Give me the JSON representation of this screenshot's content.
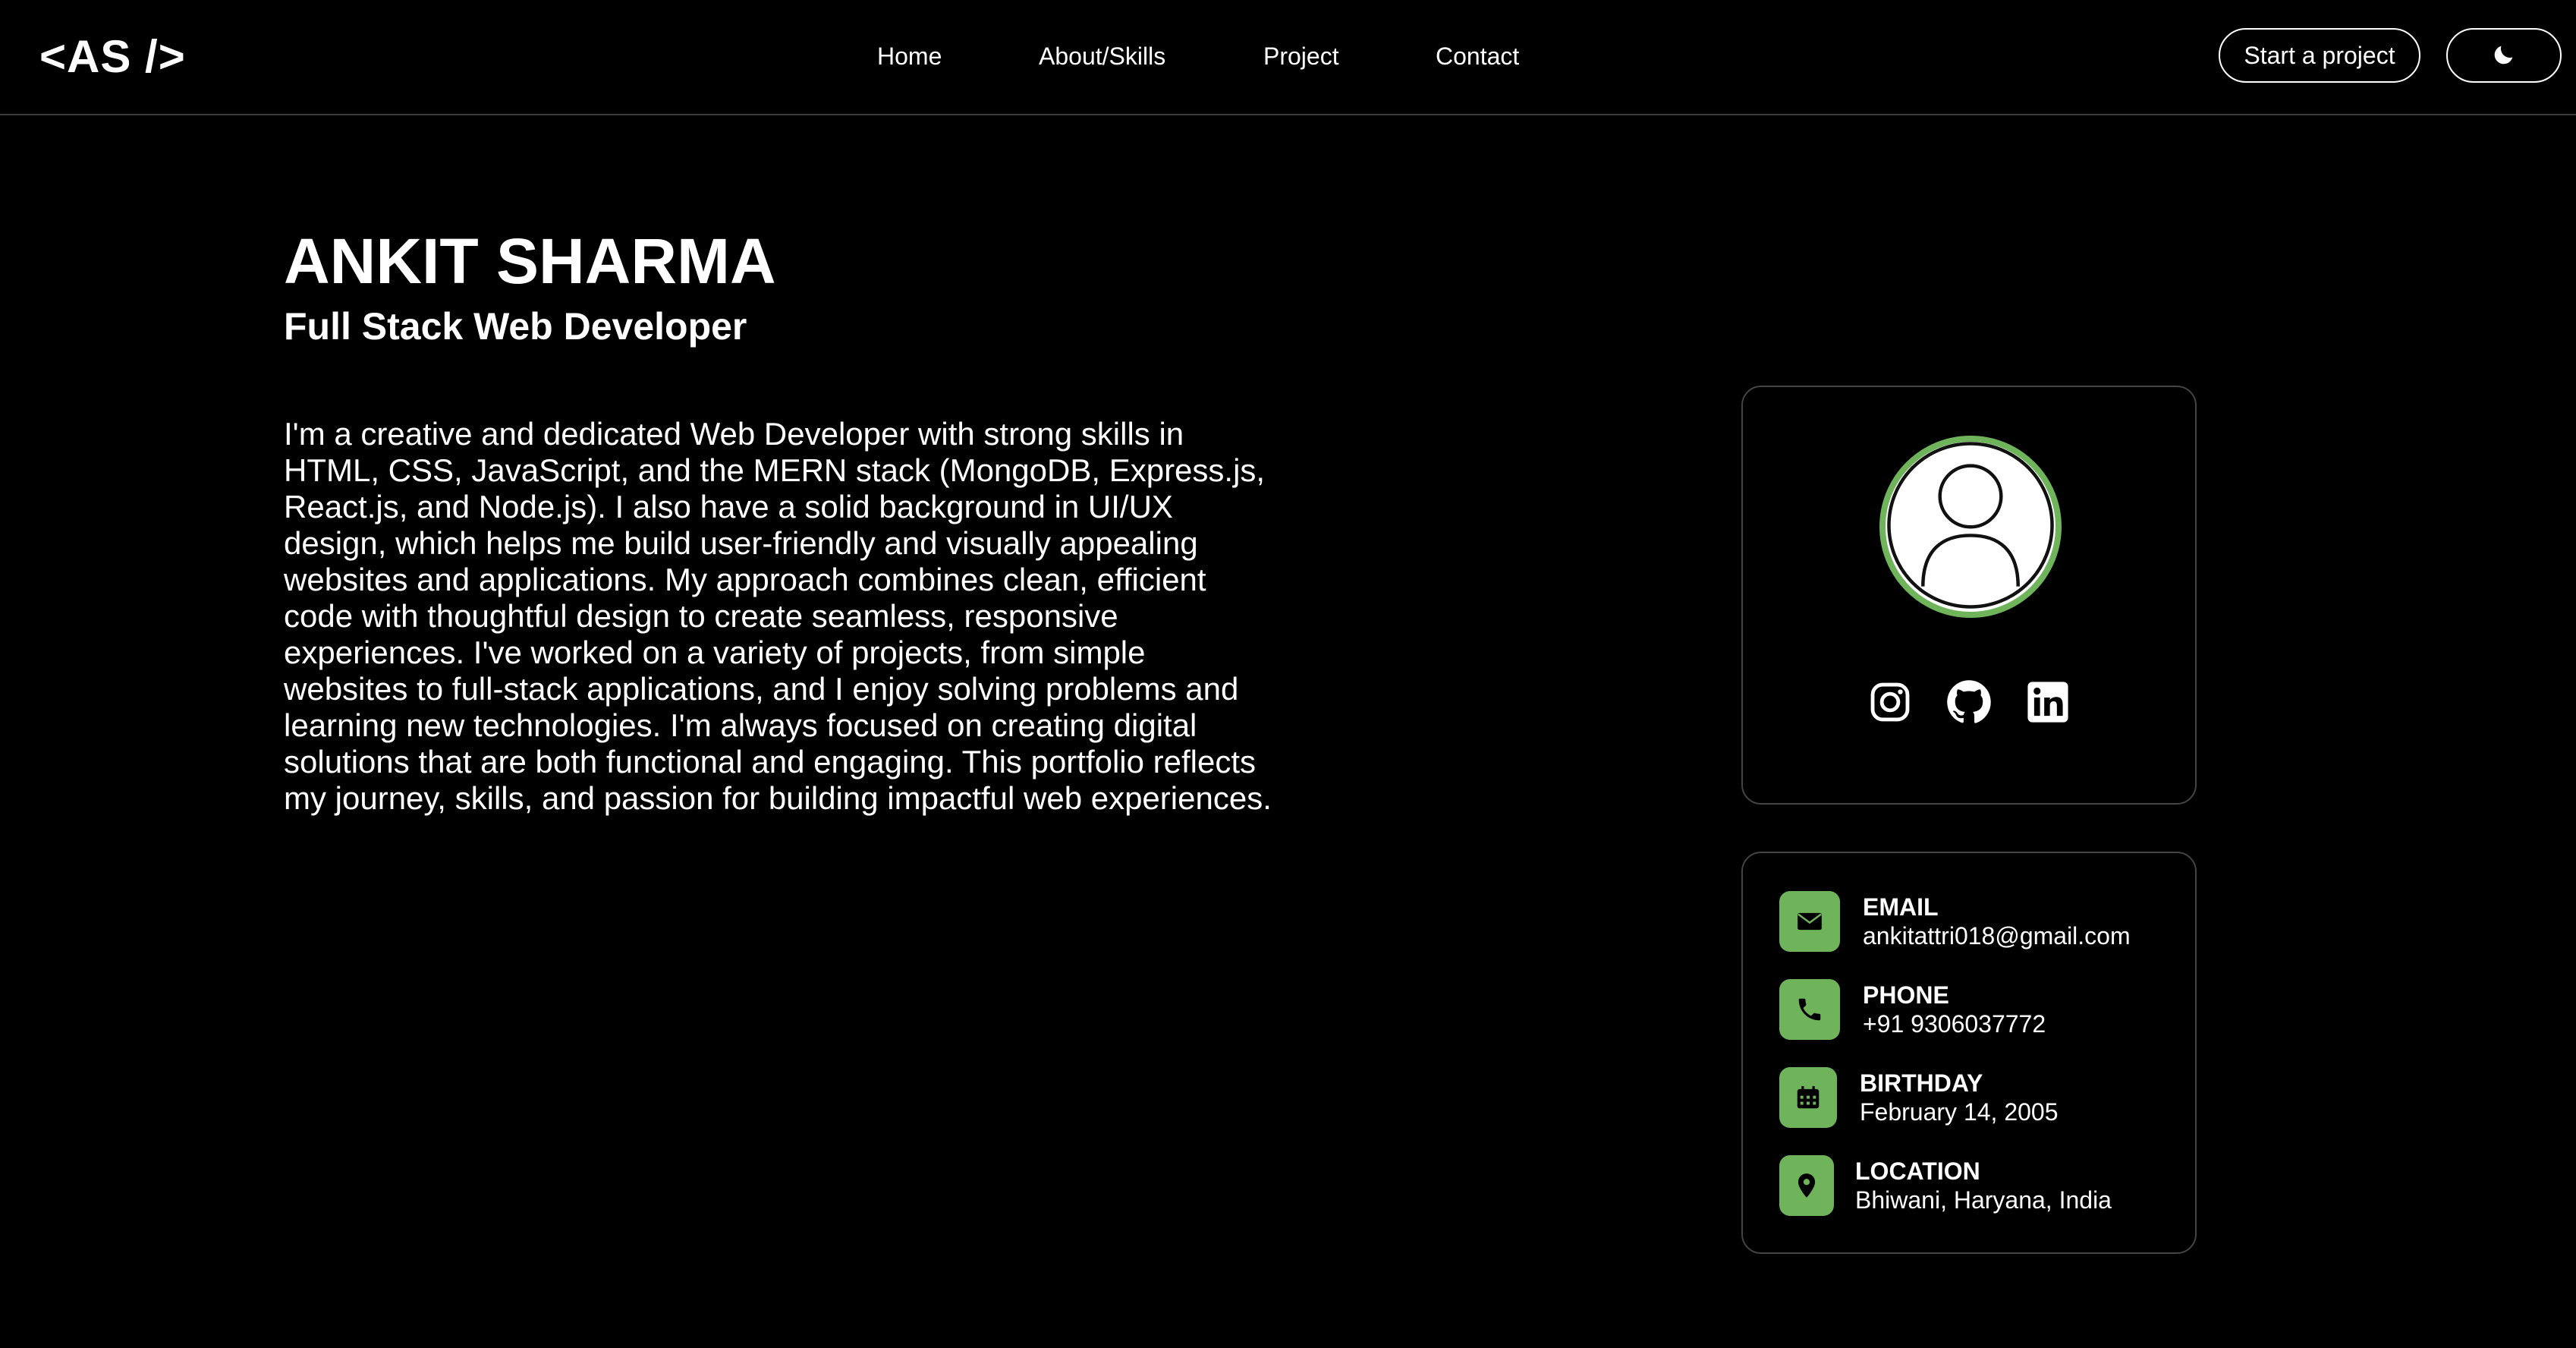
{
  "nav": {
    "logo": "<AS />",
    "links": [
      {
        "label": "Home"
      },
      {
        "label": "About/Skills"
      },
      {
        "label": "Project"
      },
      {
        "label": "Contact"
      }
    ],
    "cta_label": "Start a project",
    "theme_toggle_icon": "moon-icon"
  },
  "hero": {
    "name": "ANKIT SHARMA",
    "role": "Full Stack Web Developer",
    "bio": "I'm a creative and dedicated Web Developer with strong skills in HTML, CSS, JavaScript, and the MERN stack (MongoDB, Express.js, React.js, and Node.js). I also have a solid background in UI/UX design, which helps me build user-friendly and visually appealing websites and applications. My approach combines clean, efficient code with thoughtful design to create seamless, responsive experiences. I've worked on a variety of projects, from simple websites to full-stack applications, and I enjoy solving problems and learning new technologies. I'm always focused on creating digital solutions that are both functional and engaging. This portfolio reflects my journey, skills, and passion for building impactful web experiences."
  },
  "profile": {
    "avatar_icon": "user-avatar-icon",
    "socials": [
      {
        "icon": "instagram-icon"
      },
      {
        "icon": "github-icon"
      },
      {
        "icon": "linkedin-icon"
      }
    ]
  },
  "contact": {
    "items": [
      {
        "icon": "envelope-icon",
        "label": "EMAIL",
        "value": "ankitattri018@gmail.com"
      },
      {
        "icon": "phone-icon",
        "label": "PHONE",
        "value": "+91 9306037772"
      },
      {
        "icon": "calendar-icon",
        "label": "BIRTHDAY",
        "value": "February 14, 2005"
      },
      {
        "icon": "location-pin-icon",
        "label": "LOCATION",
        "value": "Bhiwani, Haryana, India"
      }
    ]
  },
  "colors": {
    "background": "#000000",
    "accent": "#6fb35b",
    "text": "#ffffff",
    "border": "#444444"
  }
}
